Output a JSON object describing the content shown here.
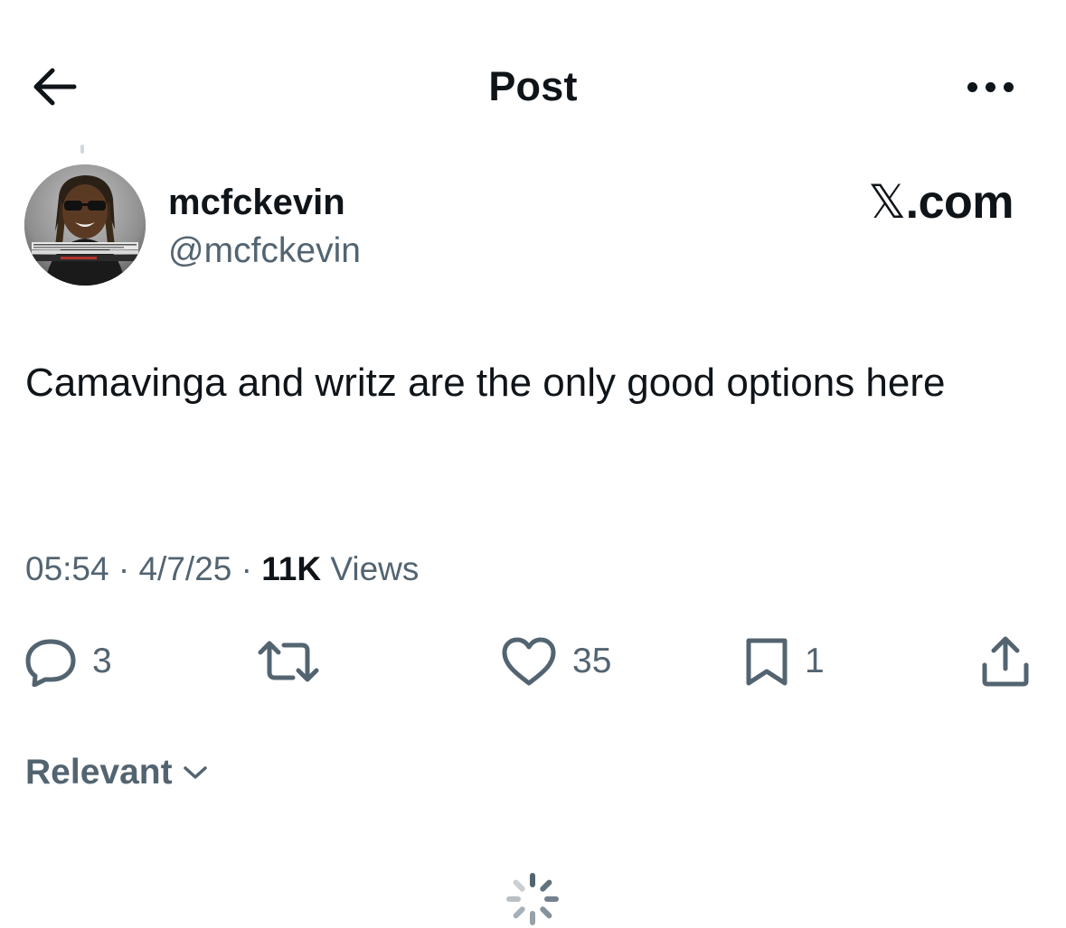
{
  "header": {
    "title": "Post",
    "back_icon": "arrow-left-icon",
    "more_icon": "more-dots-icon"
  },
  "author": {
    "name": "mcfckevin",
    "handle": "@mcfckevin",
    "source": "X.com",
    "source_glyph": "𝕏",
    "source_suffix": ".com"
  },
  "tweet": {
    "text": "Camavinga and writz are the only good options here"
  },
  "meta": {
    "time": "05:54",
    "separator": "·",
    "date": "4/7/25",
    "views_count": "11K",
    "views_label": "Views"
  },
  "actions": {
    "replies": {
      "icon": "reply-icon",
      "count": "3"
    },
    "reposts": {
      "icon": "repost-icon",
      "count": ""
    },
    "likes": {
      "icon": "heart-icon",
      "count": "35"
    },
    "bookmarks": {
      "icon": "bookmark-icon",
      "count": "1"
    },
    "share": {
      "icon": "share-icon"
    }
  },
  "replies_filter": {
    "label": "Relevant",
    "icon": "chevron-down-icon"
  },
  "colors": {
    "text_primary": "#0f1419",
    "text_secondary": "#536471",
    "background": "#ffffff"
  }
}
